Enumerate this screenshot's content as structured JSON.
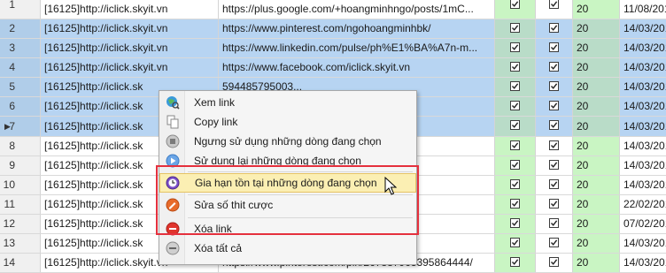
{
  "table": {
    "rows": [
      {
        "num": "1",
        "source": "[16125]http://iclick.skyit.vn",
        "url": "https://plus.google.com/+hoangminhngo/posts/1mC...",
        "chk1": true,
        "chk2": true,
        "days": "20",
        "date": "11/08/201",
        "selected": false,
        "current": false
      },
      {
        "num": "2",
        "source": "[16125]http://iclick.skyit.vn",
        "url": "https://www.pinterest.com/ngohoangminhbk/",
        "chk1": true,
        "chk2": true,
        "days": "20",
        "date": "14/03/201",
        "selected": true,
        "current": false
      },
      {
        "num": "3",
        "source": "[16125]http://iclick.skyit.vn",
        "url": "https://www.linkedin.com/pulse/ph%E1%BA%A7n-m...",
        "chk1": true,
        "chk2": true,
        "days": "20",
        "date": "14/03/201",
        "selected": true,
        "current": false
      },
      {
        "num": "4",
        "source": "[16125]http://iclick.skyit.vn",
        "url": "https://www.facebook.com/iclick.skyit.vn",
        "chk1": true,
        "chk2": true,
        "days": "20",
        "date": "14/03/201",
        "selected": true,
        "current": false
      },
      {
        "num": "5",
        "source": "[16125]http://iclick.sk",
        "url": "594485795003...",
        "chk1": true,
        "chk2": true,
        "days": "20",
        "date": "14/03/201",
        "selected": true,
        "current": false
      },
      {
        "num": "6",
        "source": "[16125]http://iclick.sk",
        "url": "",
        "chk1": true,
        "chk2": true,
        "days": "20",
        "date": "14/03/201",
        "selected": true,
        "current": false
      },
      {
        "num": "7",
        "source": "[16125]http://iclick.sk",
        "url": "nh/",
        "chk1": true,
        "chk2": true,
        "days": "20",
        "date": "14/03/201",
        "selected": true,
        "current": true
      },
      {
        "num": "8",
        "source": "[16125]http://iclick.sk",
        "url": "",
        "chk1": true,
        "chk2": true,
        "days": "20",
        "date": "14/03/201",
        "selected": false,
        "current": false
      },
      {
        "num": "9",
        "source": "[16125]http://iclick.sk",
        "url": "1z72LU",
        "chk1": true,
        "chk2": true,
        "days": "20",
        "date": "14/03/201",
        "selected": false,
        "current": false
      },
      {
        "num": "10",
        "source": "[16125]http://iclick.sk",
        "url": "posts/Nab8...",
        "chk1": true,
        "chk2": true,
        "days": "20",
        "date": "14/03/201",
        "selected": false,
        "current": false
      },
      {
        "num": "11",
        "source": "[16125]http://iclick.sk",
        "url": "posts/E7yB...",
        "chk1": true,
        "chk2": true,
        "days": "20",
        "date": "22/02/201",
        "selected": false,
        "current": false
      },
      {
        "num": "12",
        "source": "[16125]http://iclick.sk",
        "url": "posts/49s3...",
        "chk1": true,
        "chk2": true,
        "days": "20",
        "date": "07/02/201",
        "selected": false,
        "current": false
      },
      {
        "num": "13",
        "source": "[16125]http://iclick.sk",
        "url": "3295483688/",
        "chk1": true,
        "chk2": true,
        "days": "20",
        "date": "14/03/201",
        "selected": false,
        "current": false
      },
      {
        "num": "14",
        "source": "[16125]http://iclick.skyit.vn",
        "url": "https://www.pinterest.com/pin/267887963395864444/",
        "chk1": true,
        "chk2": true,
        "days": "20",
        "date": "14/03/201",
        "selected": false,
        "current": false
      }
    ]
  },
  "context_menu": {
    "items": [
      {
        "label": "Xem link",
        "icon": "globe-view-icon"
      },
      {
        "label": "Copy link",
        "icon": "copy-icon"
      },
      {
        "label": "Ngưng sử dụng những dòng đang chọn",
        "icon": "stop-icon"
      },
      {
        "label": "Sử dụng lại những dòng đang chọn",
        "icon": "play-icon"
      },
      {
        "label": "Gia hạn tồn tại những dòng đang chọn",
        "icon": "extend-time-icon"
      },
      {
        "label": "Sửa số thit cược",
        "icon": "edit-bet-icon"
      },
      {
        "label": "Xóa link",
        "icon": "delete-icon"
      },
      {
        "label": "Xóa tất cả",
        "icon": "delete-all-icon"
      }
    ]
  },
  "colors": {
    "selected_row": "#b7d4f2",
    "green_column": "#c9f5c3",
    "menu_highlight": "#fbefb3",
    "annotation_box": "#e5303d"
  }
}
